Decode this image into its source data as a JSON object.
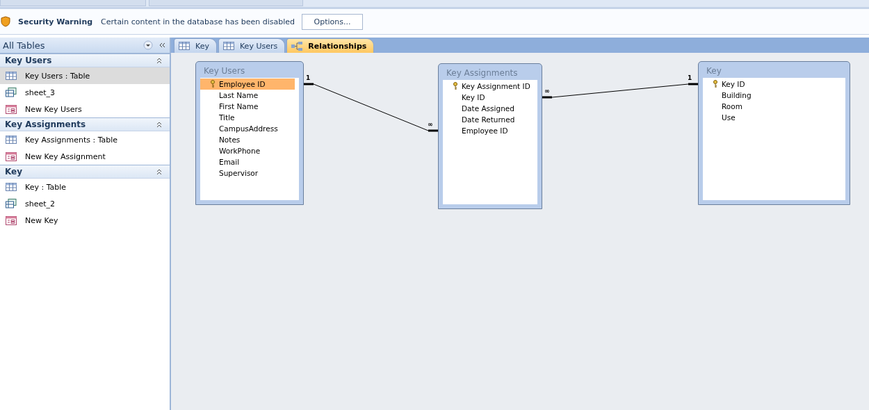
{
  "security_bar": {
    "title": "Security Warning",
    "message": "Certain content in the database has been disabled",
    "button": "Options..."
  },
  "nav_pane": {
    "title": "All Tables",
    "groups": [
      {
        "title": "Key Users",
        "expanded": true,
        "items": [
          {
            "label": "Key Users : Table",
            "kind": "table",
            "selected": true
          },
          {
            "label": "sheet_3",
            "kind": "pivot",
            "selected": false
          },
          {
            "label": "New Key Users",
            "kind": "form",
            "selected": false
          }
        ]
      },
      {
        "title": "Key Assignments",
        "expanded": true,
        "items": [
          {
            "label": "Key Assignments : Table",
            "kind": "table",
            "selected": false
          },
          {
            "label": "New Key Assignment",
            "kind": "form",
            "selected": false
          }
        ]
      },
      {
        "title": "Key",
        "expanded": true,
        "items": [
          {
            "label": "Key : Table",
            "kind": "table",
            "selected": false
          },
          {
            "label": "sheet_2",
            "kind": "pivot",
            "selected": false
          },
          {
            "label": "New Key",
            "kind": "form",
            "selected": false
          }
        ]
      }
    ]
  },
  "tabs": [
    {
      "label": "Key",
      "kind": "table",
      "selected": false
    },
    {
      "label": "Key Users",
      "kind": "table",
      "selected": false
    },
    {
      "label": "Relationships",
      "kind": "relationships",
      "selected": true
    }
  ],
  "tables": [
    {
      "title": "Key Users",
      "fields": [
        {
          "name": "Employee ID",
          "primary_key": true,
          "selected": true
        },
        {
          "name": "Last Name",
          "primary_key": false,
          "selected": false
        },
        {
          "name": "First Name",
          "primary_key": false,
          "selected": false
        },
        {
          "name": "Title",
          "primary_key": false,
          "selected": false
        },
        {
          "name": "CampusAddress",
          "primary_key": false,
          "selected": false
        },
        {
          "name": "Notes",
          "primary_key": false,
          "selected": false
        },
        {
          "name": "WorkPhone",
          "primary_key": false,
          "selected": false
        },
        {
          "name": "Email",
          "primary_key": false,
          "selected": false
        },
        {
          "name": "Supervisor",
          "primary_key": false,
          "selected": false
        }
      ]
    },
    {
      "title": "Key Assignments",
      "fields": [
        {
          "name": "Key Assignment ID",
          "primary_key": true,
          "selected": false
        },
        {
          "name": "Key ID",
          "primary_key": false,
          "selected": false
        },
        {
          "name": "Date Assigned",
          "primary_key": false,
          "selected": false
        },
        {
          "name": "Date Returned",
          "primary_key": false,
          "selected": false
        },
        {
          "name": "Employee ID",
          "primary_key": false,
          "selected": false
        }
      ]
    },
    {
      "title": "Key",
      "fields": [
        {
          "name": "Key ID",
          "primary_key": true,
          "selected": false
        },
        {
          "name": "Building",
          "primary_key": false,
          "selected": false
        },
        {
          "name": "Room",
          "primary_key": false,
          "selected": false
        },
        {
          "name": "Use",
          "primary_key": false,
          "selected": false
        }
      ]
    }
  ],
  "relationships": [
    {
      "from_label": "1",
      "to_label": "∞"
    },
    {
      "from_label": "∞",
      "to_label": "1"
    }
  ]
}
